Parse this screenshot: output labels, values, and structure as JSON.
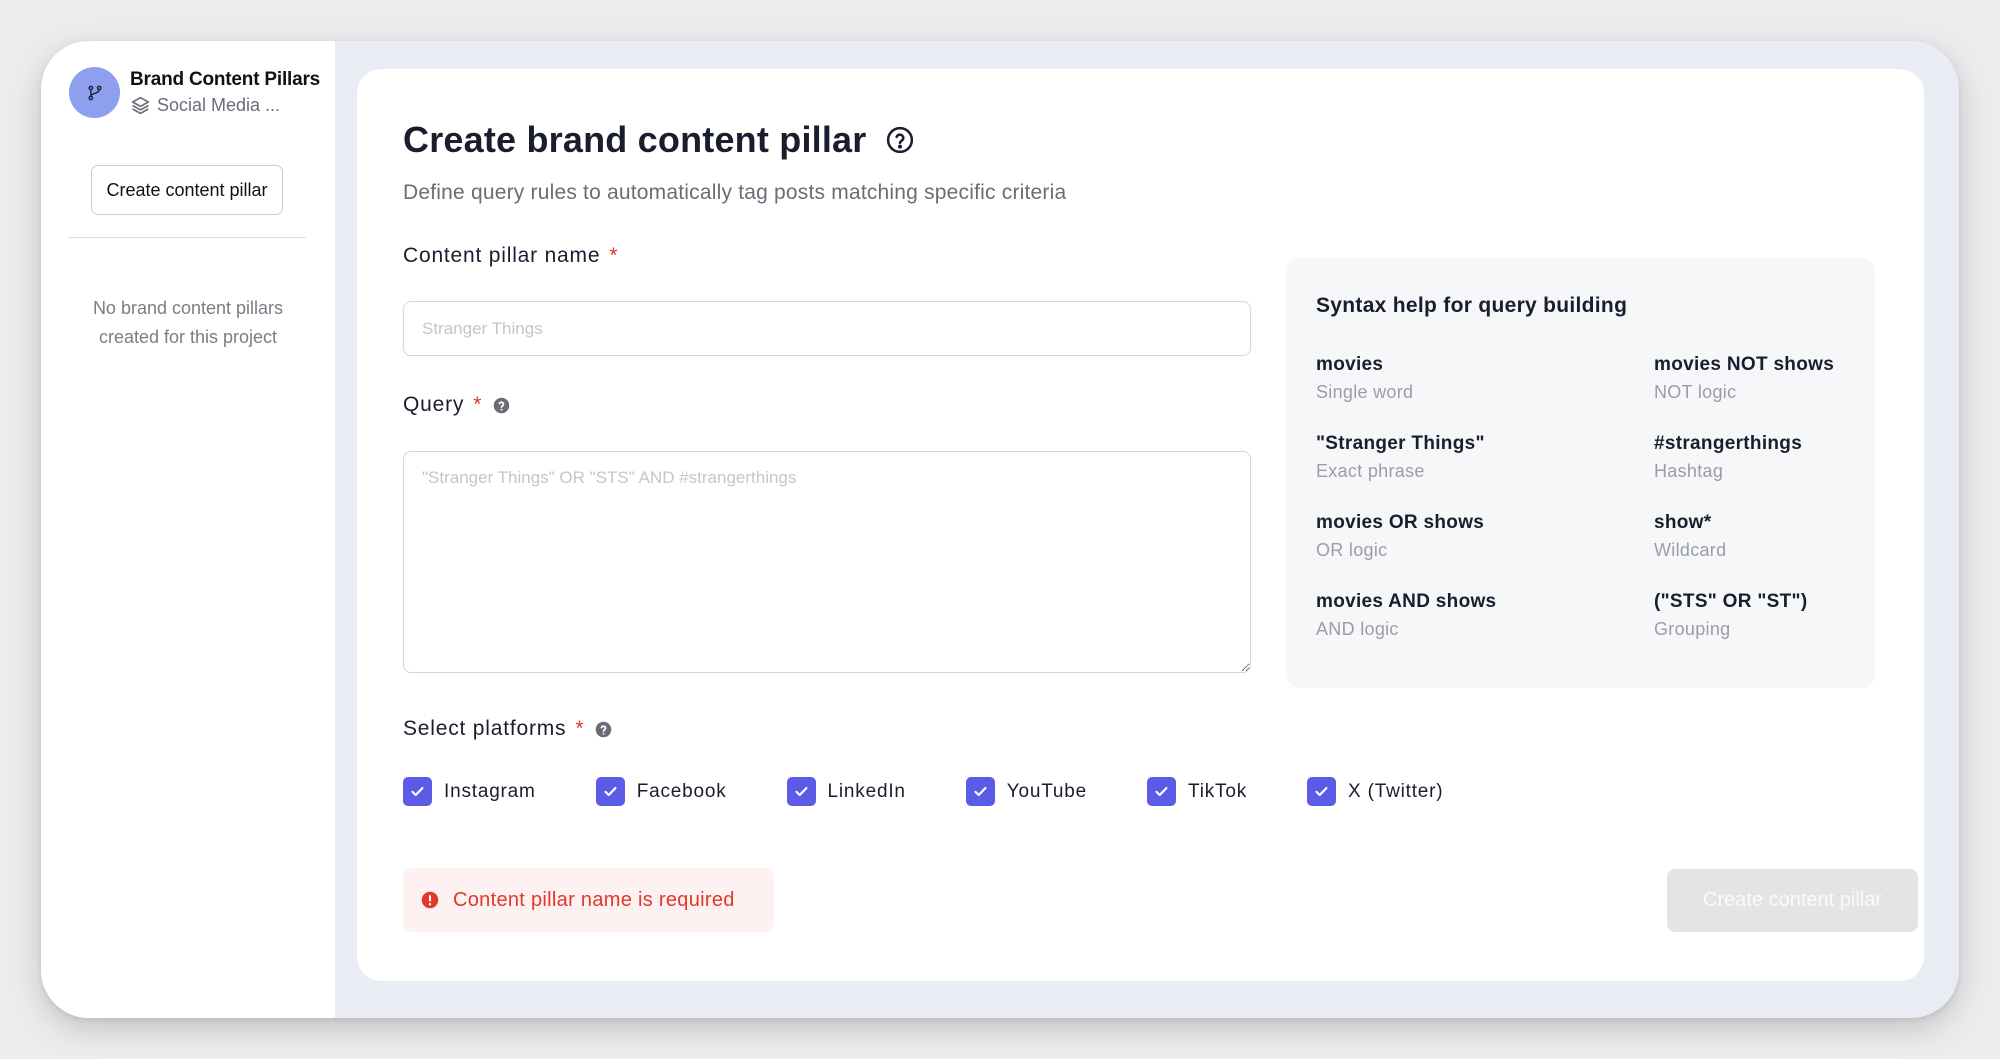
{
  "sidebar": {
    "project_title": "Brand Content Pillars",
    "project_subtitle": "Social Media ...",
    "create_button": "Create content pillar",
    "empty_state": "No brand content pillars created for this project"
  },
  "form": {
    "title": "Create brand content pillar",
    "subtitle": "Define query rules to automatically tag posts matching specific criteria",
    "name_label": "Content pillar name",
    "name_value": "",
    "name_placeholder": "Stranger Things",
    "query_label": "Query",
    "query_value": "",
    "query_placeholder": "\"Stranger Things\" OR \"STS\" AND #strangerthings",
    "required_mark": "*",
    "platforms_label": "Select platforms",
    "platforms": [
      {
        "label": "Instagram",
        "checked": true
      },
      {
        "label": "Facebook",
        "checked": true
      },
      {
        "label": "LinkedIn",
        "checked": true
      },
      {
        "label": "YouTube",
        "checked": true
      },
      {
        "label": "TikTok",
        "checked": true
      },
      {
        "label": "X (Twitter)",
        "checked": true
      }
    ],
    "error": "Content pillar name is required",
    "submit": "Create content pillar"
  },
  "syntax": {
    "title": "Syntax help for query building",
    "items": [
      {
        "code": "movies",
        "desc": "Single word"
      },
      {
        "code": "movies NOT shows",
        "desc": "NOT logic"
      },
      {
        "code": "\"Stranger Things\"",
        "desc": "Exact phrase"
      },
      {
        "code": "#strangerthings",
        "desc": "Hashtag"
      },
      {
        "code": "movies OR shows",
        "desc": "OR logic"
      },
      {
        "code": "show*",
        "desc": "Wildcard"
      },
      {
        "code": "movies AND shows",
        "desc": "AND logic"
      },
      {
        "code": "(\"STS\" OR \"ST\")",
        "desc": "Grouping"
      }
    ]
  },
  "colors": {
    "accent": "#5b5be8",
    "avatar": "#8e9ff0",
    "error": "#e0392b",
    "error_bg": "#fdf1f1",
    "disabled_button": "#e3e4e6"
  }
}
